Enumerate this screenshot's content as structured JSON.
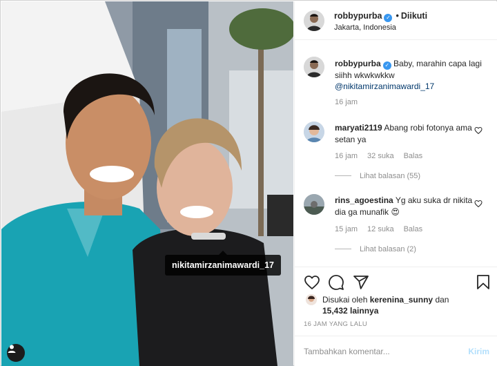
{
  "post": {
    "username": "robbypurba",
    "verified": true,
    "follow_status": "Diikuti",
    "location": "Jakarta, Indonesia",
    "photo_tag": "nikitamirzanimawardi_17"
  },
  "caption": {
    "username": "robbypurba",
    "text": "Baby, marahin capa lagi siihh wkwkwkkw",
    "mention": "@nikitamirzanimawardi_17",
    "time": "16 jam"
  },
  "comments": [
    {
      "username": "maryati2119",
      "text": "Abang robi fotonya ama setan ya",
      "time": "16 jam",
      "likes": "32 suka",
      "reply_label": "Balas",
      "view_replies": "Lihat balasan (55)"
    },
    {
      "username": "rins_agoestina",
      "text": "Yg aku suka dr nikita dia ga munafik 😍",
      "time": "15 jam",
      "likes": "12 suka",
      "reply_label": "Balas",
      "view_replies": "Lihat balasan (2)"
    }
  ],
  "likes": {
    "prefix": "Disukai oleh",
    "user": "kerenina_sunny",
    "connector": "dan",
    "others": "15,432 lainnya"
  },
  "timestamp": "16 JAM YANG LALU",
  "comment_box": {
    "placeholder": "Tambahkan komentar...",
    "post_label": "Kirim"
  },
  "icons": {
    "like": "heart-icon",
    "comment": "comment-icon",
    "share": "share-icon",
    "save": "bookmark-icon",
    "tags": "user-tag-icon"
  },
  "colors": {
    "verified": "#3897f0",
    "mention": "#00376b",
    "muted": "#8e8e8e",
    "post_button": "#b2dffc"
  }
}
